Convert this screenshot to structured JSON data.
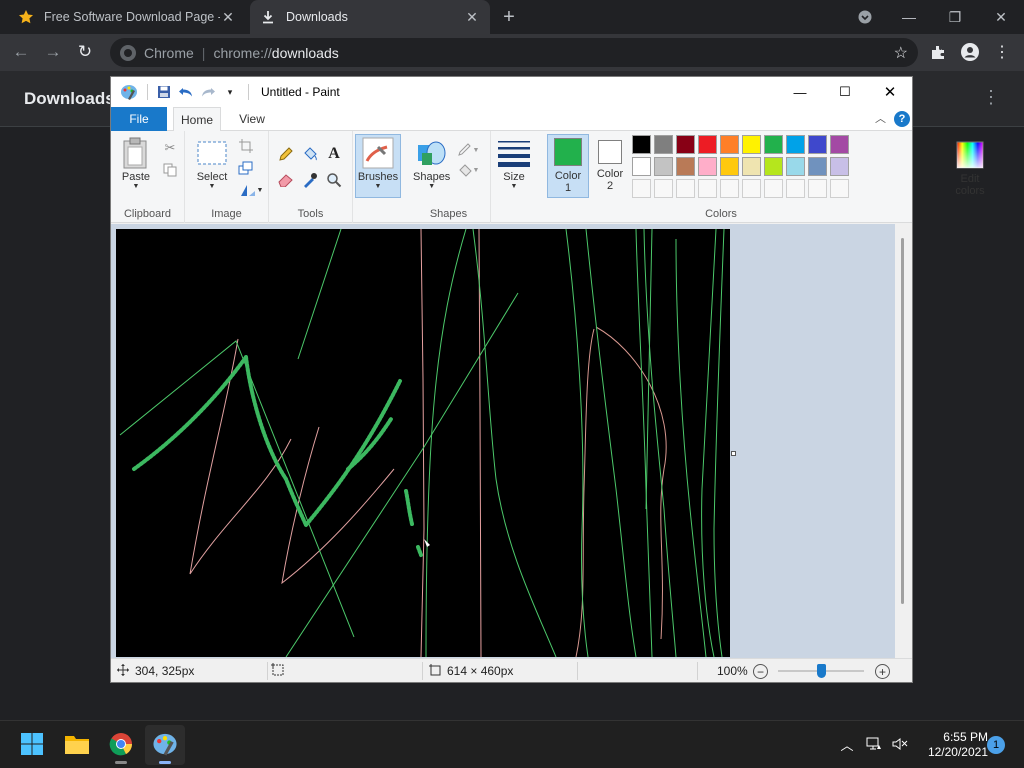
{
  "chrome": {
    "tabs": [
      {
        "title": "Free Software Download Page - S"
      },
      {
        "title": "Downloads"
      }
    ],
    "omnibox": {
      "site": "Chrome",
      "url_scheme": "chrome://",
      "url_host": "downloads"
    },
    "page_title": "Downloads"
  },
  "paint": {
    "title": "Untitled - Paint",
    "ribbon_tabs": [
      "File",
      "Home",
      "View"
    ],
    "groups": {
      "clipboard": {
        "label": "Clipboard",
        "paste": "Paste"
      },
      "image": {
        "label": "Image",
        "select": "Select"
      },
      "tools": {
        "label": "Tools"
      },
      "brushes": {
        "label": "Brushes"
      },
      "shapes": {
        "label": "Shapes",
        "shapes_btn": "Shapes"
      },
      "size": {
        "label": "Size"
      },
      "colors": {
        "label": "Colors",
        "color1": "Color\n1",
        "color1_a": "Color",
        "color1_b": "1",
        "color2_a": "Color",
        "color2_b": "2",
        "edit_a": "Edit",
        "edit_b": "colors",
        "color1_value": "#22b14c",
        "color2_value": "#ffffff",
        "palette_row1": [
          "#000000",
          "#7f7f7f",
          "#880015",
          "#ed1c24",
          "#ff7f27",
          "#fff200",
          "#22b14c",
          "#00a2e8",
          "#3f48cc",
          "#a349a4"
        ],
        "palette_row2": [
          "#ffffff",
          "#c3c3c3",
          "#b97a57",
          "#ffaec9",
          "#ffc90e",
          "#efe4b0",
          "#b5e61d",
          "#99d9ea",
          "#7092be",
          "#c8bfe7"
        ]
      }
    },
    "status": {
      "cursor_pos": "304, 325px",
      "image_size": "614 × 460px",
      "zoom": "100%"
    }
  },
  "taskbar": {
    "time": "6:55 PM",
    "date": "12/20/2021",
    "notifications": "1"
  }
}
